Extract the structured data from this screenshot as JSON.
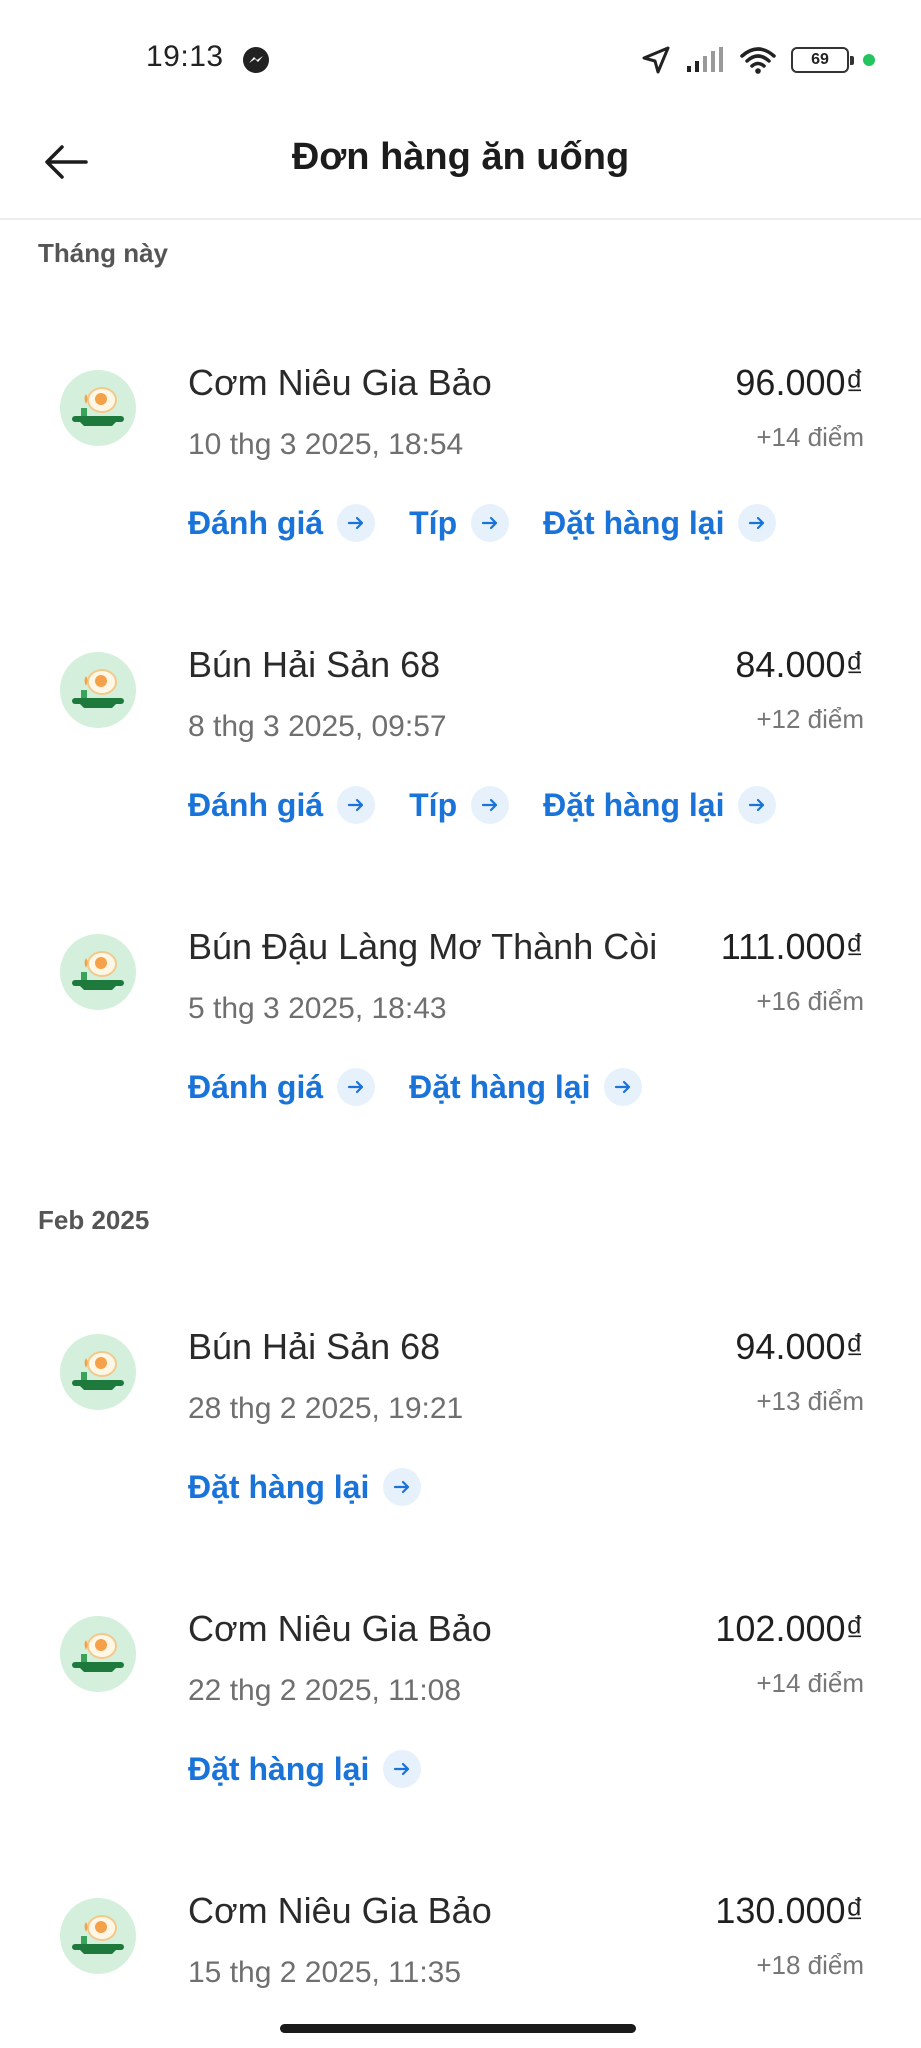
{
  "status_bar": {
    "time": "19:13",
    "battery": "69",
    "icons": [
      "messenger-icon",
      "location-arrow-icon",
      "signal-icon",
      "wifi-icon",
      "battery-icon",
      "green-dot-indicator"
    ]
  },
  "header": {
    "title": "Đơn hàng ăn uống",
    "back_icon": "arrow-left-icon"
  },
  "sections": [
    {
      "label": "Tháng này",
      "orders": [
        {
          "name": "Cơm Niêu Gia Bảo",
          "date": "10 thg 3 2025, 18:54",
          "price": "96.000₫",
          "points": "+14 điểm",
          "actions": [
            "Đánh giá",
            "Típ",
            "Đặt hàng lại"
          ]
        },
        {
          "name": "Bún Hải Sản 68",
          "date": "8 thg 3 2025, 09:57",
          "price": "84.000₫",
          "points": "+12 điểm",
          "actions": [
            "Đánh giá",
            "Típ",
            "Đặt hàng lại"
          ]
        },
        {
          "name": "Bún Đậu Làng Mơ Thành Còi",
          "date": "5 thg 3 2025, 18:43",
          "price": "111.000₫",
          "points": "+16 điểm",
          "actions": [
            "Đánh giá",
            "Đặt hàng lại"
          ]
        }
      ]
    },
    {
      "label": "Feb 2025",
      "orders": [
        {
          "name": "Bún Hải Sản 68",
          "date": "28 thg 2 2025, 19:21",
          "price": "94.000₫",
          "points": "+13 điểm",
          "actions": [
            "Đặt hàng lại"
          ]
        },
        {
          "name": "Cơm Niêu Gia Bảo",
          "date": "22 thg 2 2025, 11:08",
          "price": "102.000₫",
          "points": "+14 điểm",
          "actions": [
            "Đặt hàng lại"
          ]
        },
        {
          "name": "Cơm Niêu Gia Bảo",
          "date": "15 thg 2 2025, 11:35",
          "price": "130.000₫",
          "points": "+18 điểm",
          "actions": []
        }
      ]
    }
  ],
  "colors": {
    "accent": "#1a73d9",
    "avatar_bg": "#d4f0dc",
    "avatar_plate": "#1e7a3c",
    "status_dot": "#22c55e"
  }
}
